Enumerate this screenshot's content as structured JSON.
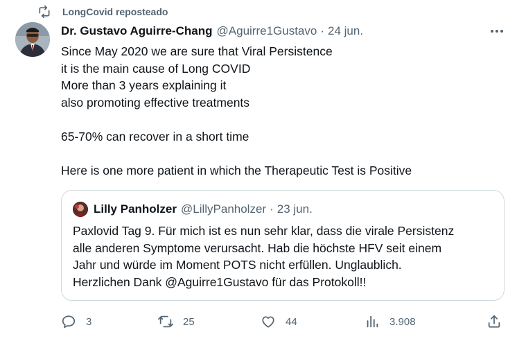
{
  "repost": {
    "label": "LongCovid reposteado",
    "icon": "repost-icon"
  },
  "tweet": {
    "author_name": "Dr. Gustavo Aguirre-Chang",
    "handle": "@Aguirre1Gustavo",
    "separator": "·",
    "time": "24 jun.",
    "avatar_icon": "avatar",
    "more_icon": "more-icon",
    "lines": [
      "Since May 2020 we are sure that Viral Persistence",
      "it is the main cause of Long COVID",
      "More than 3 years explaining it",
      "also promoting effective treatments",
      "",
      "65-70% can recover in a short time",
      "",
      "Here is one more patient in which the Therapeutic Test is Positive"
    ]
  },
  "quote": {
    "author_name": "Lilly Panholzer",
    "handle": "@LillyPanholzer",
    "separator": "·",
    "time": "23 jun.",
    "lines": [
      "Paxlovid Tag 9. Für mich ist es nun sehr klar, dass die virale Persistenz",
      "alle anderen Symptome verursacht. Hab die höchste HFV seit einem",
      "Jahr und würde im Moment POTS nicht erfüllen. Unglaublich.",
      "Herzlichen Dank @Aguirre1Gustavo für das Protokoll!!"
    ]
  },
  "actions": {
    "reply": {
      "icon": "reply-icon",
      "count": "3"
    },
    "retweet": {
      "icon": "retweet-icon",
      "count": "25"
    },
    "like": {
      "icon": "heart-icon",
      "count": "44"
    },
    "views": {
      "icon": "views-icon",
      "count": "3.908"
    },
    "share": {
      "icon": "share-icon"
    }
  },
  "colors": {
    "text": "#0f1419",
    "secondary": "#536471",
    "border": "#cfd9de"
  }
}
